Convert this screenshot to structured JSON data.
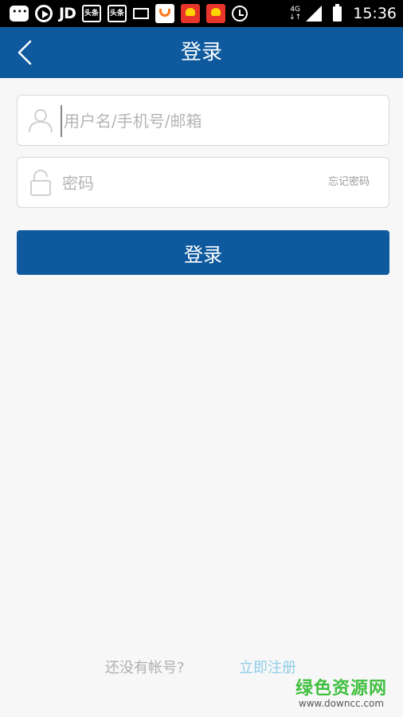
{
  "status_bar": {
    "icons": [
      "chat-icon",
      "play-icon",
      "jd-icon",
      "toutiao-icon",
      "toutiao-icon",
      "mail-icon",
      "app-icon",
      "app-red-icon",
      "app-red-icon",
      "alarm-icon"
    ],
    "jd_label": "JD",
    "toutiao_label": "头条",
    "network": "4G",
    "network_arrows": "↓↑",
    "time": "15:36"
  },
  "header": {
    "title": "登录",
    "background": "#0f5a9e"
  },
  "form": {
    "username_placeholder": "用户名/手机号/邮箱",
    "password_placeholder": "密码",
    "forgot_password": "忘记密码",
    "login_button": "登录"
  },
  "footer": {
    "no_account": "还没有帐号?",
    "register": "立即注册"
  },
  "watermark": {
    "main": "绿色资源网",
    "sub": "www.downcc.com"
  },
  "colors": {
    "primary": "#0f5a9e",
    "link": "#8fcde8",
    "watermark": "#3fbf3f"
  }
}
